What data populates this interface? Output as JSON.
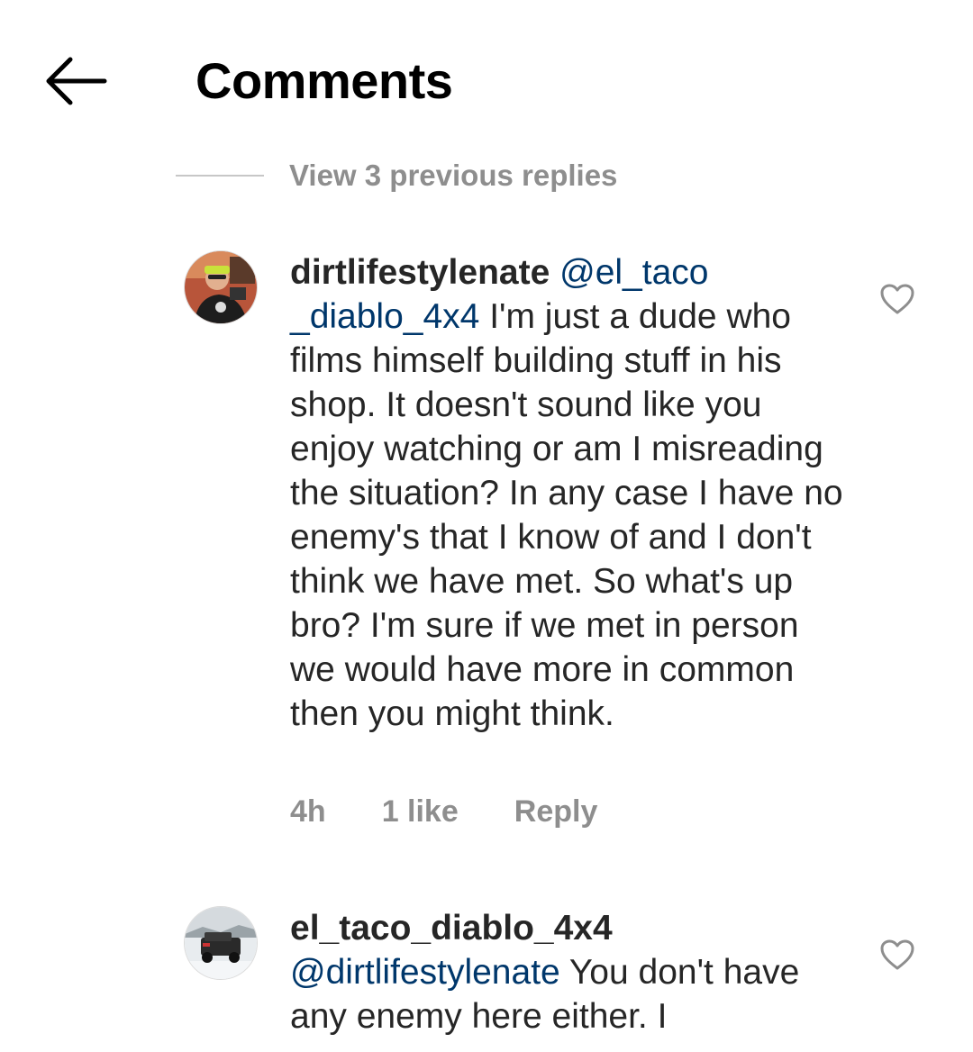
{
  "header": {
    "title": "Comments",
    "back_icon": "arrow-left-icon"
  },
  "thread": {
    "view_previous_label": "View 3 previous replies"
  },
  "comments": [
    {
      "username": "dirtlifestylenate",
      "mention": "@el_taco _diablo_4x4",
      "text": "I'm just a dude who films himself building stuff in his shop. It doesn't sound like you enjoy watching or am I misreading the situation? In any case I have no enemy's that I know of and I don't think we have met. So what's up bro? I'm sure if we met in person we would have more in common then you might think.",
      "time": "4h",
      "likes": "1 like",
      "reply_label": "Reply",
      "like_icon": "heart-outline-icon"
    },
    {
      "username": "el_taco_diablo_4x4",
      "mention": "@dirtlifestylenate",
      "text": "You don't have any enemy here either. I",
      "like_icon": "heart-outline-icon"
    }
  ],
  "colors": {
    "mention": "#00376b",
    "secondary_text": "#8e8e8e",
    "primary_text": "#262626",
    "divider": "#c7c7c7"
  }
}
